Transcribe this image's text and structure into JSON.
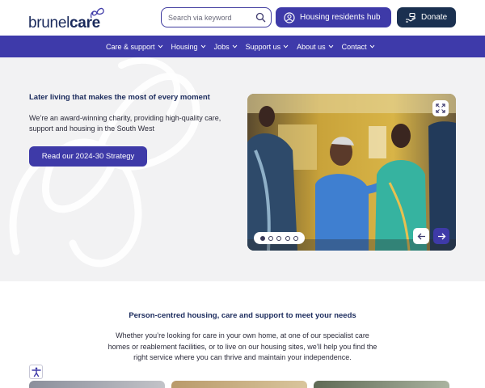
{
  "header": {
    "logo": {
      "part1": "brunel",
      "part2": "care"
    },
    "search": {
      "placeholder": "Search via keyword"
    },
    "hub_button": "Housing residents hub",
    "donate_button": "Donate"
  },
  "nav": {
    "items": [
      {
        "label": "Care & support"
      },
      {
        "label": "Housing"
      },
      {
        "label": "Jobs"
      },
      {
        "label": "Support us"
      },
      {
        "label": "About us"
      },
      {
        "label": "Contact"
      }
    ]
  },
  "hero": {
    "tagline": "Later living that makes the most of every moment",
    "intro": "We’re an award-winning charity, providing high-quality care, support and housing in the South West",
    "cta": "Read our 2024-30 Strategy",
    "carousel": {
      "slide_count": 5,
      "active_index": 0
    }
  },
  "section": {
    "title": "Person-centred housing, care and support to meet your needs",
    "body": "Whether you’re looking for care in your own home, at one of our specialist care homes or reablement facilities, or to live on our housing sites, we’ll help you find the right service where you can thrive and maintain your independence."
  },
  "colors": {
    "brand_purple": "#3e3aa8",
    "brand_navy": "#1a3050",
    "hero_bg": "#f2f2f3"
  }
}
